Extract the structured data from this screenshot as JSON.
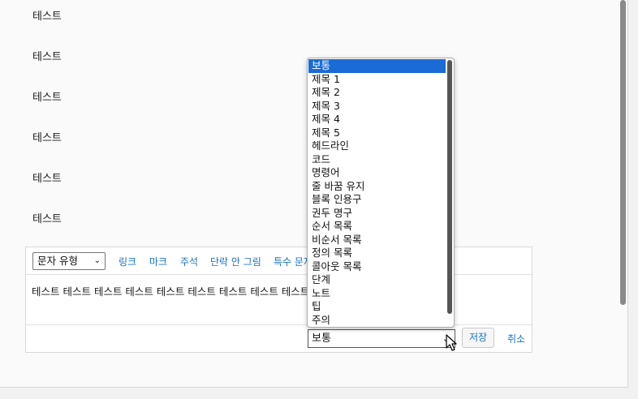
{
  "paragraphs": [
    "테스트",
    "테스트",
    "테스트",
    "테스트",
    "테스트",
    "테스트"
  ],
  "toolbar": {
    "block_type_select": "문자 유형",
    "links": [
      "링크",
      "마크",
      "주석",
      "단락 안 그림",
      "특수 문자"
    ]
  },
  "editor": {
    "content": "테스트 테스트 테스트 테스트 테스트 테스트 테스트 테스트 테스트 테스트"
  },
  "footer": {
    "block_select_value": "보통",
    "save_label": "저장",
    "cancel_label": "취소"
  },
  "dropdown": {
    "selected_index": 0,
    "options": [
      "보통",
      "제목 1",
      "제목 2",
      "제목 3",
      "제목 4",
      "제목 5",
      "헤드라인",
      "코드",
      "명령어",
      "줄 바꿈 유지",
      "블록 인용구",
      "권두 명구",
      "순서 목록",
      "비순서 목록",
      "정의 목록",
      "콜아웃 목록",
      "단계",
      "노트",
      "팁",
      "주의"
    ]
  },
  "colors": {
    "accent": "#1a73c8",
    "selected_option": "#1a6bd6"
  }
}
